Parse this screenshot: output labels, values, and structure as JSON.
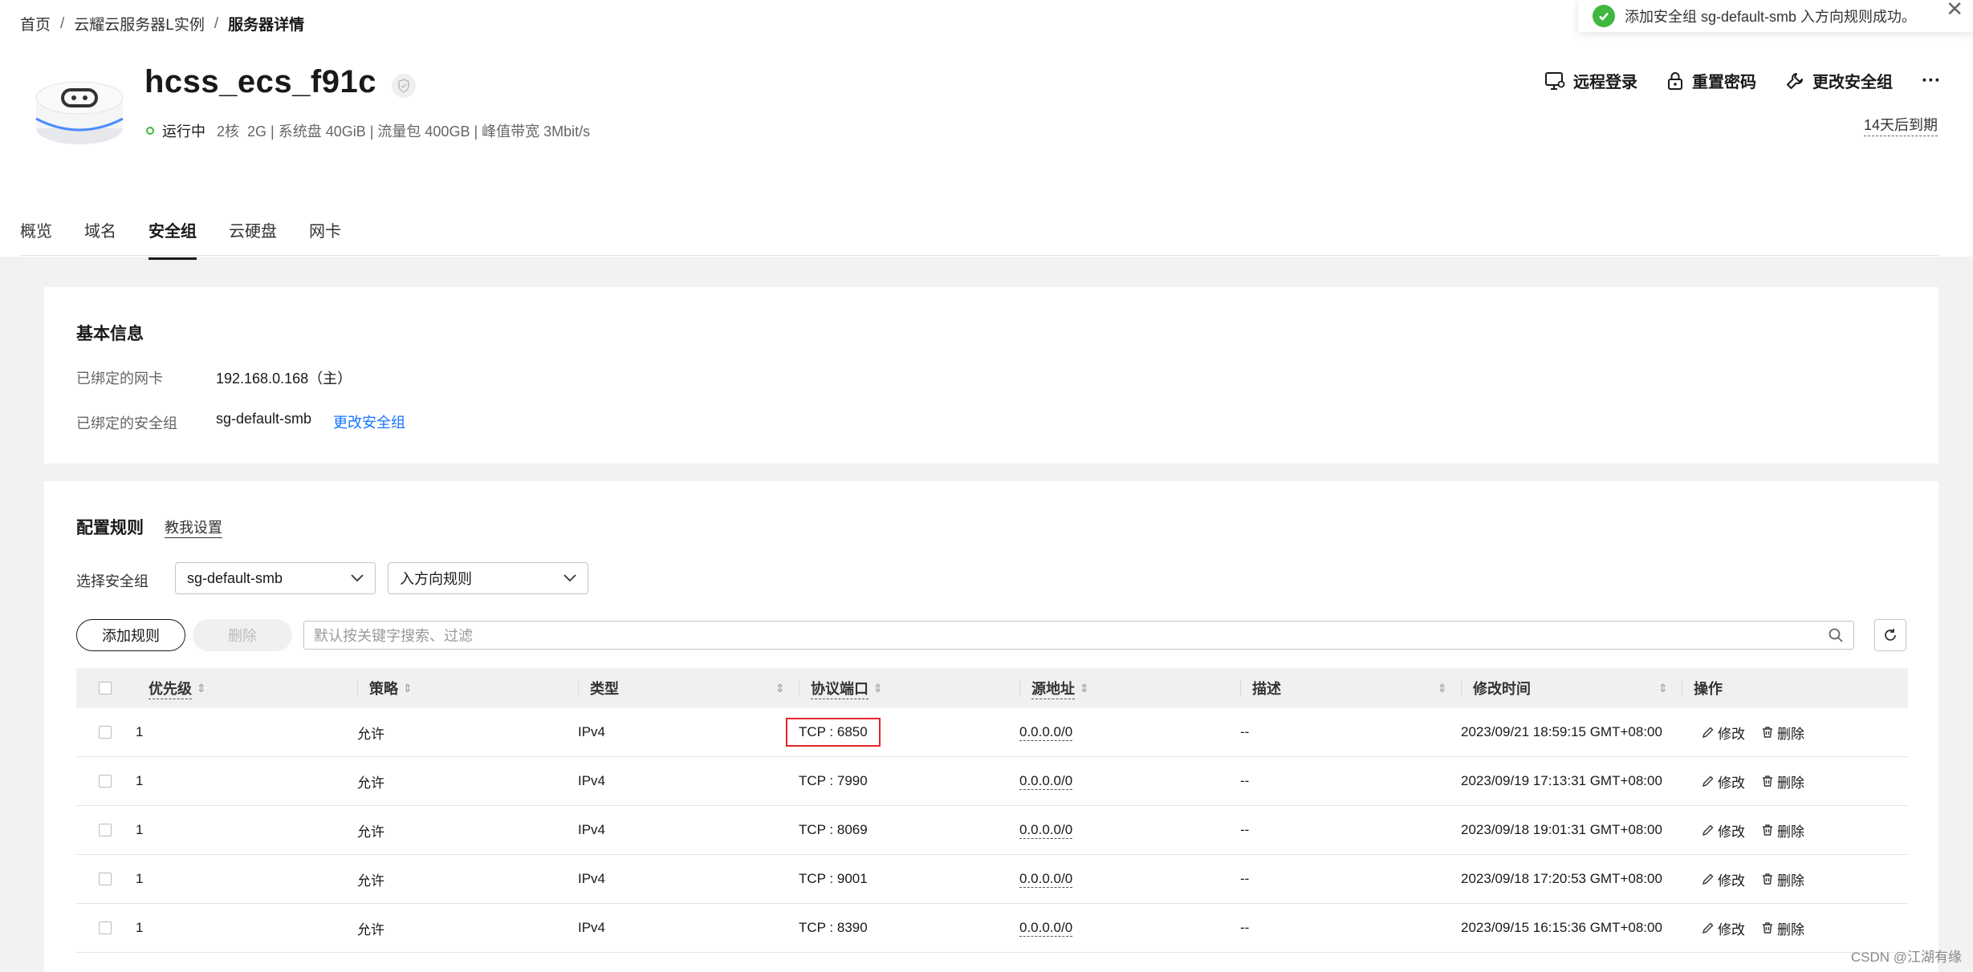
{
  "breadcrumb": {
    "home": "首页",
    "instances": "云耀云服务器L实例",
    "current": "服务器详情",
    "sep": "/"
  },
  "server": {
    "name": "hcss_ecs_f91c",
    "status": "运行中",
    "specs": "2核  2G | 系统盘 40GiB | 流量包 400GB | 峰值带宽 3Mbit/s",
    "expire": "14天后到期"
  },
  "actions": {
    "remote_login": "远程登录",
    "reset_password": "重置密码",
    "change_sg": "更改安全组",
    "more": "···"
  },
  "toast": {
    "message": "添加安全组 sg-default-smb 入方向规则成功。",
    "close": "✕"
  },
  "tabs": [
    "概览",
    "域名",
    "安全组",
    "云硬盘",
    "网卡"
  ],
  "basic_info": {
    "title": "基本信息",
    "nic_label": "已绑定的网卡",
    "nic_value": "192.168.0.168（主）",
    "sg_label": "已绑定的安全组",
    "sg_value": "sg-default-smb",
    "sg_change": "更改安全组"
  },
  "rules": {
    "title": "配置规则",
    "teach": "教我设置",
    "select_label": "选择安全组",
    "select_sg": "sg-default-smb",
    "select_direction": "入方向规则",
    "add_button": "添加规则",
    "delete_button": "删除",
    "search_placeholder": "默认按关键字搜索、过滤",
    "columns": [
      "优先级",
      "策略",
      "类型",
      "协议端口",
      "源地址",
      "描述",
      "修改时间",
      "操作"
    ],
    "edit": "修改",
    "delete": "删除",
    "rows": [
      {
        "priority": "1",
        "policy": "允许",
        "type": "IPv4",
        "port": "TCP : 6850",
        "source": "0.0.0.0/0",
        "desc": "--",
        "time": "2023/09/21 18:59:15 GMT+08:00"
      },
      {
        "priority": "1",
        "policy": "允许",
        "type": "IPv4",
        "port": "TCP : 7990",
        "source": "0.0.0.0/0",
        "desc": "--",
        "time": "2023/09/19 17:13:31 GMT+08:00"
      },
      {
        "priority": "1",
        "policy": "允许",
        "type": "IPv4",
        "port": "TCP : 8069",
        "source": "0.0.0.0/0",
        "desc": "--",
        "time": "2023/09/18 19:01:31 GMT+08:00"
      },
      {
        "priority": "1",
        "policy": "允许",
        "type": "IPv4",
        "port": "TCP : 9001",
        "source": "0.0.0.0/0",
        "desc": "--",
        "time": "2023/09/18 17:20:53 GMT+08:00"
      },
      {
        "priority": "1",
        "policy": "允许",
        "type": "IPv4",
        "port": "TCP : 8390",
        "source": "0.0.0.0/0",
        "desc": "--",
        "time": "2023/09/15 16:15:36 GMT+08:00"
      }
    ]
  },
  "watermark": "CSDN @江湖有缘",
  "colors": {
    "accent_link": "#1476ff",
    "success": "#3fb83f",
    "highlight": "#e5252a"
  }
}
